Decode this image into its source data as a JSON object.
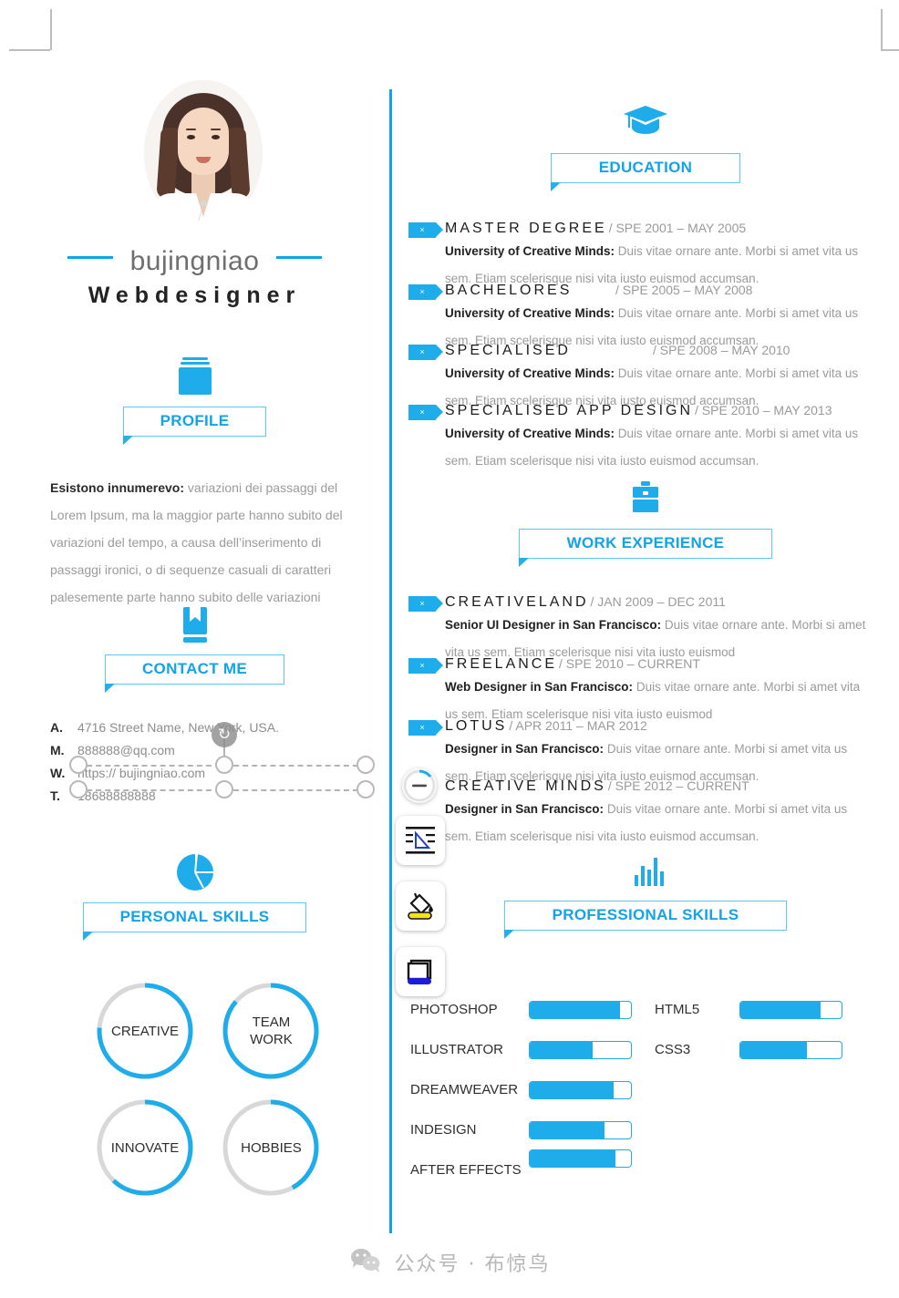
{
  "theme": {
    "accent": "#0aa6e8",
    "accent_light": "#5ec8f2",
    "body_text": "#9b9b9b",
    "dark_text": "#1f1f1f"
  },
  "header": {
    "name": "bujingniao",
    "role": "Webdesigner",
    "photo_alt": "portrait-photo"
  },
  "profile": {
    "icon": "documents-icon",
    "title": "PROFILE",
    "lead": "Esistono innumerevo:",
    "body": " variazioni dei passaggi del Lorem Ipsum, ma la maggior parte hanno subito del variazioni del tempo, a causa dell’inserimento di passaggi ironici, o di sequenze casuali di caratteri palesemente parte hanno subito delle variazioni"
  },
  "contact": {
    "icon": "book-icon",
    "title": "CONTACT ME",
    "rows": [
      {
        "key": "A.",
        "value": "4716 Street Name, New York,  USA."
      },
      {
        "key": "M.",
        "value": "888888@qq.com"
      },
      {
        "key": "W.",
        "value": "https:// bujingniao.com"
      },
      {
        "key": "T.",
        "value": "18688888888"
      }
    ]
  },
  "personal_skills": {
    "icon": "pie-chart-icon",
    "title": "PERSONAL SKILLS",
    "items": [
      {
        "label": "CREATIVE",
        "percent": 76
      },
      {
        "label": "TEAM\nWORK",
        "percent": 86
      },
      {
        "label": "INNOVATE",
        "percent": 62
      },
      {
        "label": "HOBBIES",
        "percent": 42
      }
    ]
  },
  "education": {
    "icon": "graduation-cap-icon",
    "title": "EDUCATION",
    "entries": [
      {
        "tag": "broken-image-icon",
        "title": "MASTER DEGREE",
        "date": "/ SPE 2001 – MAY 2005",
        "org": "University of Creative Minds:",
        "desc": " Duis vitae ornare ante. Morbi si amet vita us sem. Etiam scelerisque nisi vita iusto euismod accumsan."
      },
      {
        "tag": "broken-image-icon",
        "title": "BACHELORES",
        "date": "/ SPE 2005 – MAY 2008",
        "org": "University of Creative Minds:",
        "desc": " Duis vitae ornare ante. Morbi si amet vita us sem. Etiam scelerisque nisi vita iusto euismod accumsan."
      },
      {
        "tag": "broken-image-icon",
        "title": "SPECIALISED",
        "date": "/ SPE 2008 – MAY 2010",
        "org": "University of Creative Minds:",
        "desc": " Duis vitae ornare ante. Morbi si amet vita us sem. Etiam scelerisque nisi vita iusto euismod accumsan."
      },
      {
        "tag": "broken-image-icon",
        "title": "SPECIALISED APP DESIGN",
        "date": "/ SPE 2010 – MAY 2013",
        "org": "University of Creative Minds:",
        "desc": " Duis vitae ornare ante. Morbi si amet vita us sem. Etiam scelerisque nisi vita iusto euismod accumsan."
      }
    ]
  },
  "work": {
    "icon": "briefcase-icon",
    "title": "WORK EXPERIENCE",
    "entries": [
      {
        "tag": "broken-image-icon",
        "title": "CREATIVELAND",
        "date": "/ JAN 2009 – DEC 2011",
        "org": "Senior UI Designer in San Francisco:",
        "desc": "  Duis vitae ornare ante. Morbi si amet vita us sem. Etiam scelerisque nisi vita iusto euismod"
      },
      {
        "tag": "broken-image-icon",
        "title": "FREELANCE",
        "date": "/ SPE 2010 – CURRENT",
        "org": "Web Designer in San Francisco:",
        "desc": " Duis vitae ornare ante. Morbi si amet vita us sem. Etiam scelerisque nisi vita iusto euismod"
      },
      {
        "tag": "broken-image-icon",
        "title": "LOTUS",
        "date": "/ APR 2011 – MAR 2012",
        "org": "Designer in San Francisco:",
        "desc": " Duis vitae ornare ante. Morbi si amet vita us sem. Etiam scelerisque nisi vita iusto euismod accumsan."
      },
      {
        "tag": "minus-circle-icon",
        "title": "CREATIVE MINDS",
        "date": "/ SPE 2012 – CURRENT",
        "org": "Designer in San Francisco:",
        "desc": " Duis vitae ornare ante. Morbi si amet vita us sem. Etiam scelerisque nisi vita iusto euismod accumsan."
      }
    ]
  },
  "professional_skills": {
    "icon": "bar-chart-icon",
    "title": "PROFESSIONAL SKILLS",
    "left_column": [
      {
        "label": "PHOTOSHOP",
        "percent": 89
      },
      {
        "label": "ILLUSTRATOR",
        "percent": 62
      },
      {
        "label": "DREAMWEAVER",
        "percent": 83
      },
      {
        "label": "INDESIGN",
        "percent": 74
      },
      {
        "label": "AFTER EFFECTS",
        "percent": 85
      }
    ],
    "right_column": [
      {
        "label": "HTML5",
        "percent": 79
      },
      {
        "label": "CSS3",
        "percent": 66
      }
    ]
  },
  "toolbar": {
    "items": [
      {
        "name": "progress-knob-tool",
        "glyph": "—"
      },
      {
        "name": "text-shape-tool",
        "glyph": ""
      },
      {
        "name": "fill-bucket-tool",
        "glyph": ""
      },
      {
        "name": "shape-tool",
        "glyph": ""
      }
    ]
  },
  "footer": {
    "watermark": "公众号 · 布惊鸟"
  }
}
